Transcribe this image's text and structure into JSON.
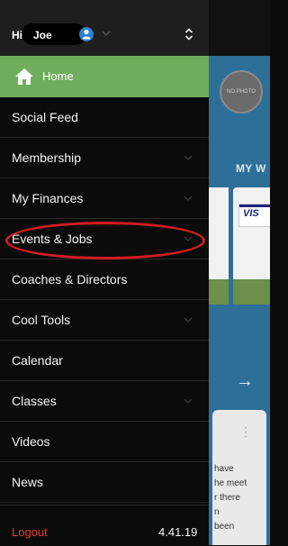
{
  "header": {
    "greeting": "Hi",
    "user_name": "Joe"
  },
  "menu": {
    "home_label": "Home",
    "items": [
      {
        "label": "Social Feed"
      },
      {
        "label": "Membership"
      },
      {
        "label": "My Finances"
      },
      {
        "label": "Events & Jobs"
      },
      {
        "label": "Coaches & Directors"
      },
      {
        "label": "Cool Tools"
      },
      {
        "label": "Calendar"
      },
      {
        "label": "Classes"
      },
      {
        "label": "Videos"
      },
      {
        "label": "News"
      }
    ]
  },
  "footer": {
    "logout_label": "Logout",
    "version": "4.41.19"
  },
  "background": {
    "wallet_heading": "MY W",
    "avatar_text": "NO PHOTO",
    "card_text": "VIS",
    "message_lines": [
      "have",
      "he meet",
      "r there",
      "n",
      "been"
    ]
  },
  "colors": {
    "home_highlight": "#6fae5c",
    "annotation_ellipse": "#d21c23",
    "logout": "#e53935",
    "background_app": "#2d6f97"
  }
}
